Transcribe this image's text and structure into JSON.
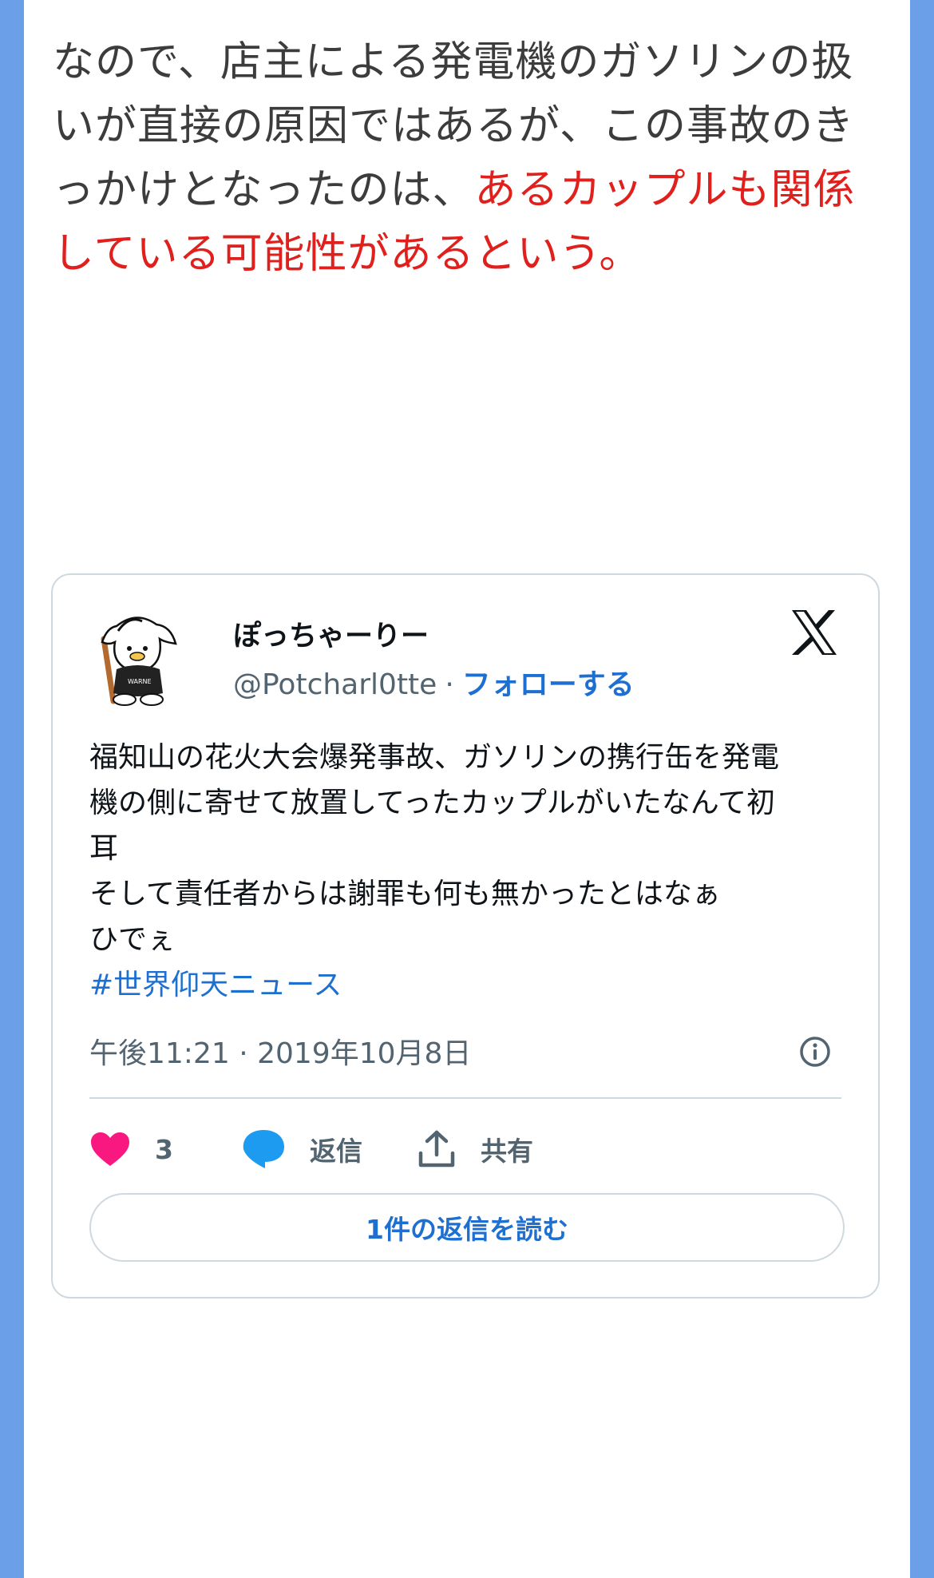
{
  "article": {
    "text_normal": "なので、店主による発電機のガソリンの扱いが直接の原因ではあるが、この事故のきっかけとなったのは、",
    "text_highlight": "あるカップルも関係している可能性があるという。"
  },
  "tweet": {
    "display_name": "ぽっちゃーりー",
    "handle": "@Potcharl0tte",
    "separator": "·",
    "follow_label": "フォローする",
    "body_lines": [
      "福知山の花火大会爆発事故、ガソリンの携行缶を発電",
      "機の側に寄せて放置してったカップルがいたなんて初",
      "耳",
      "そして責任者からは謝罪も何も無かったとはなぁ",
      "ひでぇ"
    ],
    "hashtag": "#世界仰天ニュース",
    "timestamp": "午後11:21 · 2019年10月8日",
    "like_count": "3",
    "reply_label": "返信",
    "share_label": "共有",
    "read_replies_label": "1件の返信を読む"
  },
  "colors": {
    "background_blue": "#6ba0e8",
    "highlight_red": "#e0201c",
    "link_blue": "#1d6fd1",
    "like_pink": "#f91880",
    "reply_blue": "#1d9bf0"
  },
  "icons": {
    "brand": "x-logo-icon",
    "info": "info-icon",
    "like": "heart-icon",
    "reply": "speech-bubble-icon",
    "share": "share-upload-icon"
  }
}
